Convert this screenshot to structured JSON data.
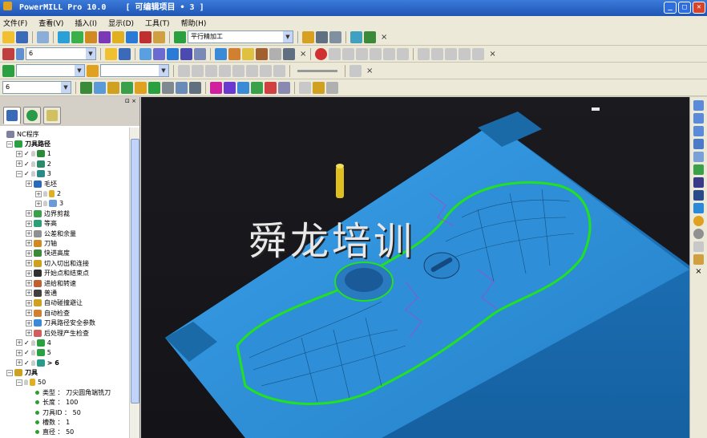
{
  "window": {
    "app_title": "PowerMILL Pro 10.0",
    "project_title": "[ 可编辑项目 • 3 ]",
    "minimize": "_",
    "maximize": "□",
    "close": "✕"
  },
  "menu": [
    "文件(F)",
    "查看(V)",
    "插入(I)",
    "显示(D)",
    "工具(T)",
    "帮助(H)"
  ],
  "toolbar1": {
    "strategy_combo": "平行精加工",
    "close": "×"
  },
  "toolbar2": {
    "tool_combo": "6",
    "close": "×"
  },
  "toolbar3": {
    "combo_a": "",
    "combo_b": "",
    "close": "×"
  },
  "toolbar4": {
    "toolpath_combo": "6"
  },
  "panel": {
    "pin": "⊡ ×"
  },
  "tree": {
    "items": [
      {
        "text": "NC程序",
        "bold": false
      },
      {
        "text": "刀具路径",
        "bold": true
      },
      {
        "text": "1"
      },
      {
        "text": "2"
      },
      {
        "text": "3"
      },
      {
        "text": "毛坯"
      },
      {
        "text": "2"
      },
      {
        "text": "3"
      },
      {
        "text": "边界剪裁"
      },
      {
        "text": "等高"
      },
      {
        "text": "公差和余量"
      },
      {
        "text": "刀轴"
      },
      {
        "text": "快进高度"
      },
      {
        "text": "切入切出和连接"
      },
      {
        "text": "开始点和结束点"
      },
      {
        "text": "进给和转速"
      },
      {
        "text": "普通"
      },
      {
        "text": "自动碰撞避让"
      },
      {
        "text": "自动检查"
      },
      {
        "text": "刀具路径安全参数"
      },
      {
        "text": "后处理产生检查"
      },
      {
        "text": "4"
      },
      {
        "text": "5"
      },
      {
        "text": "> 6"
      },
      {
        "text": "刀具",
        "bold": true
      },
      {
        "text": "50"
      },
      {
        "text": "类型 ： 刀尖圆角端铣刀"
      },
      {
        "text": "长度 ： 100"
      },
      {
        "text": "刀具ID ： 50"
      },
      {
        "text": "槽数 ： 1"
      },
      {
        "text": "直径 ： 50"
      }
    ]
  },
  "viewport": {
    "watermark": "舜龙培训"
  },
  "colors": {
    "part_blue": "#2b8fd8",
    "toolpath_green": "#22e022",
    "background": "#16161a"
  }
}
